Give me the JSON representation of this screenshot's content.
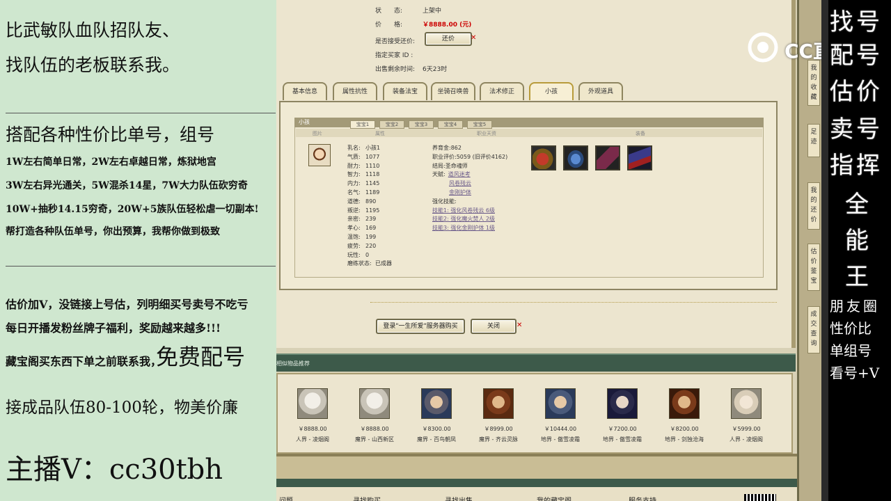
{
  "left_panel": {
    "lines": [
      "比武敏队血队招队友、",
      "找队伍的老板联系我。",
      "搭配各种性价比单号，组号",
      "1W左右简单日常，2W左右卓越日常，炼狱地宫",
      "3W左右异光通关，5W混杀14星，7W大力队伍砍穷奇",
      "10W+抽秒14.15穷奇，20W+5族队伍轻松虐一切副本!",
      "帮打造各种队伍单号，你出预算，我帮你做到极致",
      "估价加V，没链接上号估，列明细买号卖号不吃亏",
      "每日开播发粉丝牌子福利，奖励越来越多!!!",
      "藏宝阁买东西下单之前联系我，",
      "免费配号",
      "接成品队伍80-100轮，物美价廉",
      "主播V：cc30tbh"
    ]
  },
  "game": {
    "status": {
      "label": "状　　态:",
      "value": "上架中"
    },
    "price": {
      "label": "价　　格:",
      "value": "￥8888.00 (元)"
    },
    "counter_offer": {
      "label": "是否接受还价:",
      "button": "还价"
    },
    "buyer_id": {
      "label": "指定买家 ID :"
    },
    "time_left": {
      "label": "出售剩余时间:",
      "value": "6天23时"
    },
    "tabs": [
      "基本信息",
      "属性抗性",
      "装备法宝",
      "坐骑召唤兽",
      "法术修正",
      "小孩",
      "外观道具"
    ],
    "active_tab": "小孩",
    "detail": {
      "title": "小孩",
      "subtabs": [
        "宝宝1",
        "宝宝2",
        "宝宝3",
        "宝宝4",
        "宝宝5"
      ],
      "col_headers": [
        "图片",
        "属性",
        "职业天资",
        "装备"
      ],
      "attrs": [
        {
          "k": "乳名:",
          "v": "小孩1"
        },
        {
          "k": "气质:",
          "v": "1077"
        },
        {
          "k": "耐力:",
          "v": "1110"
        },
        {
          "k": "智力:",
          "v": "1118"
        },
        {
          "k": "内力:",
          "v": "1145"
        },
        {
          "k": "名气:",
          "v": "1189"
        },
        {
          "k": "道德:",
          "v": "890"
        },
        {
          "k": "叛逆:",
          "v": "1195"
        },
        {
          "k": "亲密:",
          "v": "239"
        },
        {
          "k": "孝心:",
          "v": "169"
        },
        {
          "k": "温饱:",
          "v": "199"
        },
        {
          "k": "疲劳:",
          "v": "220"
        },
        {
          "k": "玩性:",
          "v": "0"
        },
        {
          "k": "磨练状态:",
          "v": "已成器"
        }
      ],
      "career": [
        {
          "k": "养育金:",
          "v": "862"
        },
        {
          "k": "职业评价:",
          "v": "5059 (旧评价4162)"
        },
        {
          "k": "结局:",
          "v": "圣命魂师"
        },
        {
          "k": "天赋:",
          "v": "道风迷考"
        },
        {
          "k": "",
          "v": "风卷残云"
        },
        {
          "k": "",
          "v": "金刚护体"
        },
        {
          "k": "强化技能:",
          "v": ""
        },
        {
          "k": "",
          "v": "技能1: 强化风卷残云 6级"
        },
        {
          "k": "",
          "v": "技能2: 强化魔火焚人 2级"
        },
        {
          "k": "",
          "v": "技能3: 强化金刚护体 1级"
        }
      ],
      "equip_icons": [
        "pouch-icon",
        "bottle-icon",
        "scroll-icon",
        "book-icon"
      ]
    },
    "buttons": {
      "login_buy": "登录\"一生所爱\"服务器购买",
      "close": "关闭"
    },
    "recommend": {
      "title": "相似物品推荐",
      "items": [
        {
          "price": "￥8888.00",
          "server": "人界 - 凌烟阁"
        },
        {
          "price": "￥8888.00",
          "server": "魔界 - 山西新区"
        },
        {
          "price": "￥8300.00",
          "server": "魔界 - 百鸟朝凤"
        },
        {
          "price": "￥8999.00",
          "server": "魔界 - 齐云灵脉"
        },
        {
          "price": "￥10444.00",
          "server": "地界 - 傲雪凌霜"
        },
        {
          "price": "￥7200.00",
          "server": "地界 - 傲雪凌霜"
        },
        {
          "price": "￥8200.00",
          "server": "地界 - 剑独沧海"
        },
        {
          "price": "￥5999.00",
          "server": "人界 - 凌烟阁"
        }
      ]
    },
    "bottom_nav": [
      "问题",
      "寻找购买",
      "寻找出售",
      "我的藏宝阁",
      "服务支持"
    ],
    "side_tabs": [
      "我的收藏",
      "足迹",
      "我的还价",
      "估价鉴宝",
      "成交查询"
    ],
    "logo": "CC直播"
  },
  "right_panel": {
    "big": [
      "找号",
      "配号",
      "估价",
      "卖号",
      "指挥",
      "全",
      "能",
      "王"
    ],
    "small": [
      "朋友圈",
      "性价比",
      "单组号",
      "看号+V"
    ]
  }
}
